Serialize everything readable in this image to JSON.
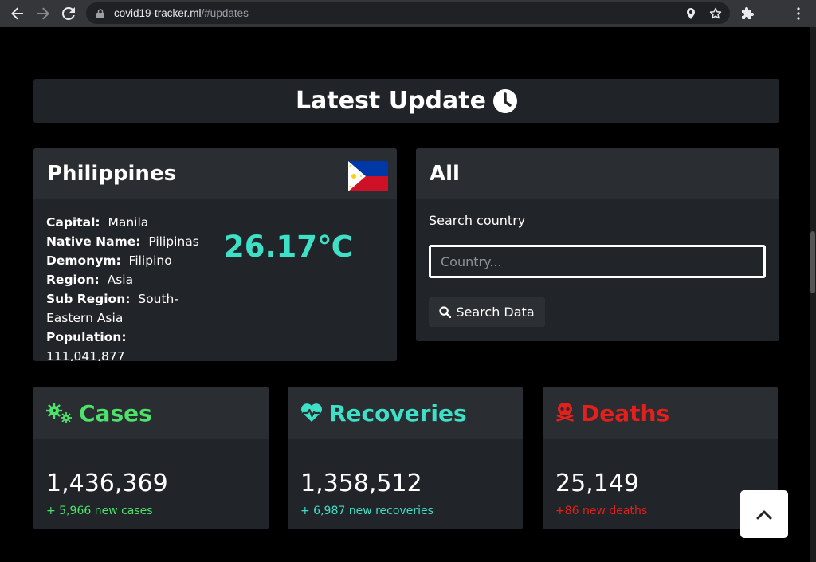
{
  "browser": {
    "url_host": "covid19-tracker.ml",
    "url_path": "/#updates"
  },
  "headline": "Latest Update",
  "country": {
    "name": "Philippines",
    "fields": [
      {
        "label": "Capital:",
        "value": "Manila"
      },
      {
        "label": "Native Name:",
        "value": "Pilipinas"
      },
      {
        "label": "Demonym:",
        "value": "Filipino"
      },
      {
        "label": "Region:",
        "value": "Asia"
      },
      {
        "label": "Sub Region:",
        "value": "South-Eastern Asia"
      },
      {
        "label": "Population:",
        "value": "111,041,877"
      }
    ],
    "temperature": "26.17℃"
  },
  "search": {
    "title": "All",
    "label": "Search country",
    "placeholder": "Country...",
    "button": "Search Data"
  },
  "stats": {
    "cases": {
      "title": "Cases",
      "value": "1,436,369",
      "new": "+ 5,966 new cases"
    },
    "recoveries": {
      "title": "Recoveries",
      "value": "1,358,512",
      "new": "+ 6,987 new recoveries"
    },
    "deaths": {
      "title": "Deaths",
      "value": "25,149",
      "new": "+86 new deaths"
    }
  },
  "colors": {
    "cases": "#4ce36a",
    "recoveries": "#3ee0c7",
    "deaths": "#e5201c"
  }
}
